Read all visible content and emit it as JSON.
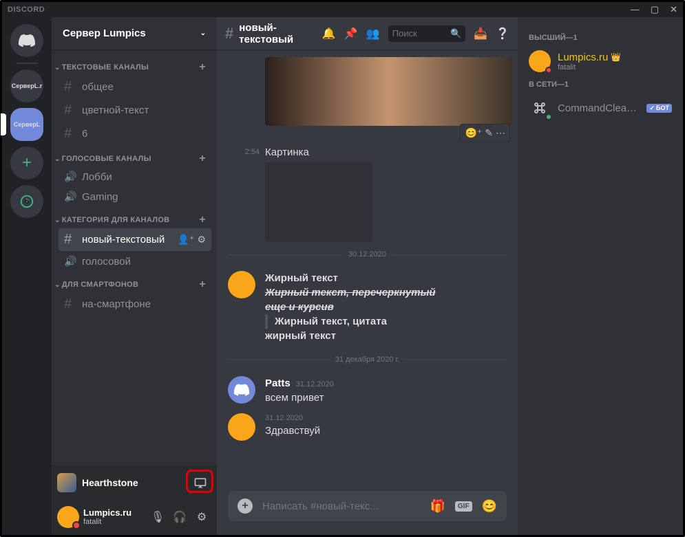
{
  "window": {
    "title": "DISCORD"
  },
  "servers": {
    "items": [
      {
        "label": "СерверL.r"
      },
      {
        "label": "СерверL"
      }
    ]
  },
  "server_header": {
    "name": "Сервер Lumpics"
  },
  "categories": [
    {
      "title": "ТЕКСТОВЫЕ КАНАЛЫ",
      "channels": [
        {
          "name": "общее",
          "type": "text"
        },
        {
          "name": "цветной-текст",
          "type": "text"
        },
        {
          "name": "6",
          "type": "text"
        }
      ]
    },
    {
      "title": "ГОЛОСОВЫЕ КАНАЛЫ",
      "channels": [
        {
          "name": "Лобби",
          "type": "voice"
        },
        {
          "name": "Gaming",
          "type": "voice"
        }
      ]
    },
    {
      "title": "КАТЕГОРИЯ ДЛЯ КАНАЛОВ",
      "channels": [
        {
          "name": "новый-текстовый",
          "type": "text",
          "active": true
        },
        {
          "name": "голосовой",
          "type": "voice"
        }
      ]
    },
    {
      "title": "ДЛЯ СМАРТФОНОВ",
      "channels": [
        {
          "name": "на-смартфоне",
          "type": "text"
        }
      ]
    }
  ],
  "activity": {
    "name": "Hearthstone"
  },
  "user": {
    "name": "Lumpics.ru",
    "sub": "fatalit"
  },
  "chat": {
    "channel_name": "новый-текстовый",
    "search_placeholder": "Поиск",
    "caption_time": "2:54",
    "caption_text": "Картинка",
    "divider1": "30.12.2020",
    "divider2": "31 декабря 2020 г.",
    "msg1": {
      "bold1": "Жирный текст",
      "strike1": "Жирный текст, перечеркнутый",
      "strike2": "еще и курсив",
      "quote": "Жирный текст, цитата",
      "bold2": "жирный текст"
    },
    "msg2": {
      "author": "Patts",
      "time": "31.12.2020",
      "text": "всем привет"
    },
    "msg3": {
      "time": "31.12.2020",
      "text": "Здравствуй"
    },
    "input_placeholder": "Написать #новый-текс...",
    "gif_label": "GIF"
  },
  "members": {
    "group1": "ВЫСШИЙ—1",
    "m1_name": "Lumpics.ru",
    "m1_sub": "fatalit",
    "group2": "В СЕТИ—1",
    "m2_name": "CommandClean...",
    "bot_label": "БОТ"
  }
}
